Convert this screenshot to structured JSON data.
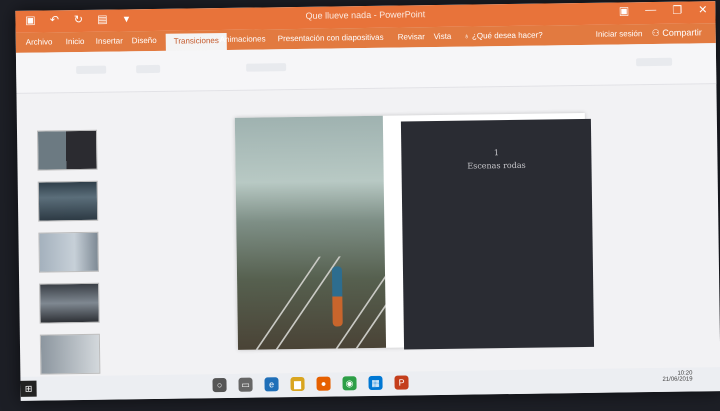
{
  "app": {
    "doc_title": "Que llueve nada - PowerPoint"
  },
  "ribbon_tabs": [
    {
      "label": "Archivo"
    },
    {
      "label": "Inicio"
    },
    {
      "label": "Insertar"
    },
    {
      "label": "Diseño"
    },
    {
      "label": "Transiciones"
    },
    {
      "label": "Animaciones"
    },
    {
      "label": "Presentación con diapositivas"
    },
    {
      "label": "Revisar"
    },
    {
      "label": "Vista"
    }
  ],
  "tell_me": "¿Qué desea hacer?",
  "account": "Iniciar sesión",
  "share": "Compartir",
  "slide": {
    "number": "1",
    "heading": "Escenas rodas"
  },
  "clock": {
    "time": "10:20",
    "date": "21/06/2019"
  },
  "colors": {
    "accent": "#e8733a",
    "slide_dark": "#2a2c33"
  }
}
